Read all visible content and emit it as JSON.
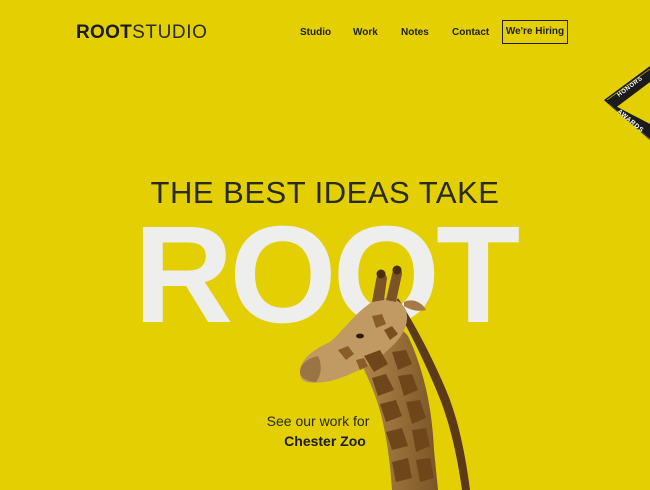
{
  "header": {
    "logo_bold": "ROOT",
    "logo_light": "STUDIO",
    "nav": {
      "studio": "Studio",
      "work": "Work",
      "notes": "Notes",
      "contact": "Contact",
      "hiring": "We're Hiring"
    }
  },
  "ribbon": {
    "top_text": "HONORS",
    "bottom_text": "AWARDS",
    "icon": "awwwards-ribbon"
  },
  "hero": {
    "tagline": "THE BEST IDEAS TAKE",
    "big_word": "ROOT",
    "cta_line": "See our work for",
    "cta_link": "Chester Zoo"
  },
  "colors": {
    "background": "#e3cf02",
    "text": "#1c1c1c",
    "big_word": "#eeeeec"
  }
}
